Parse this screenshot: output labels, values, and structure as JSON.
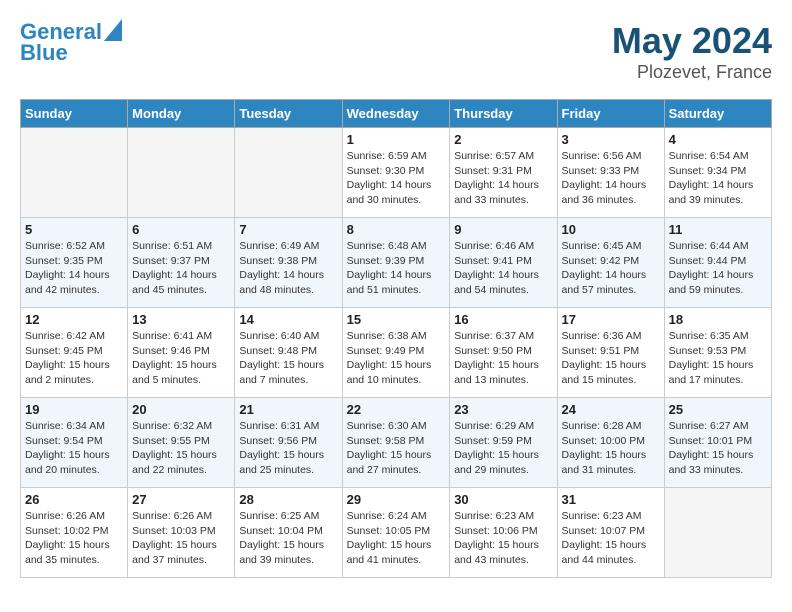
{
  "header": {
    "logo_line1": "General",
    "logo_line2": "Blue",
    "month": "May 2024",
    "location": "Plozevet, France"
  },
  "days_of_week": [
    "Sunday",
    "Monday",
    "Tuesday",
    "Wednesday",
    "Thursday",
    "Friday",
    "Saturday"
  ],
  "weeks": [
    [
      {
        "day": "",
        "info": ""
      },
      {
        "day": "",
        "info": ""
      },
      {
        "day": "",
        "info": ""
      },
      {
        "day": "1",
        "info": "Sunrise: 6:59 AM\nSunset: 9:30 PM\nDaylight: 14 hours\nand 30 minutes."
      },
      {
        "day": "2",
        "info": "Sunrise: 6:57 AM\nSunset: 9:31 PM\nDaylight: 14 hours\nand 33 minutes."
      },
      {
        "day": "3",
        "info": "Sunrise: 6:56 AM\nSunset: 9:33 PM\nDaylight: 14 hours\nand 36 minutes."
      },
      {
        "day": "4",
        "info": "Sunrise: 6:54 AM\nSunset: 9:34 PM\nDaylight: 14 hours\nand 39 minutes."
      }
    ],
    [
      {
        "day": "5",
        "info": "Sunrise: 6:52 AM\nSunset: 9:35 PM\nDaylight: 14 hours\nand 42 minutes."
      },
      {
        "day": "6",
        "info": "Sunrise: 6:51 AM\nSunset: 9:37 PM\nDaylight: 14 hours\nand 45 minutes."
      },
      {
        "day": "7",
        "info": "Sunrise: 6:49 AM\nSunset: 9:38 PM\nDaylight: 14 hours\nand 48 minutes."
      },
      {
        "day": "8",
        "info": "Sunrise: 6:48 AM\nSunset: 9:39 PM\nDaylight: 14 hours\nand 51 minutes."
      },
      {
        "day": "9",
        "info": "Sunrise: 6:46 AM\nSunset: 9:41 PM\nDaylight: 14 hours\nand 54 minutes."
      },
      {
        "day": "10",
        "info": "Sunrise: 6:45 AM\nSunset: 9:42 PM\nDaylight: 14 hours\nand 57 minutes."
      },
      {
        "day": "11",
        "info": "Sunrise: 6:44 AM\nSunset: 9:44 PM\nDaylight: 14 hours\nand 59 minutes."
      }
    ],
    [
      {
        "day": "12",
        "info": "Sunrise: 6:42 AM\nSunset: 9:45 PM\nDaylight: 15 hours\nand 2 minutes."
      },
      {
        "day": "13",
        "info": "Sunrise: 6:41 AM\nSunset: 9:46 PM\nDaylight: 15 hours\nand 5 minutes."
      },
      {
        "day": "14",
        "info": "Sunrise: 6:40 AM\nSunset: 9:48 PM\nDaylight: 15 hours\nand 7 minutes."
      },
      {
        "day": "15",
        "info": "Sunrise: 6:38 AM\nSunset: 9:49 PM\nDaylight: 15 hours\nand 10 minutes."
      },
      {
        "day": "16",
        "info": "Sunrise: 6:37 AM\nSunset: 9:50 PM\nDaylight: 15 hours\nand 13 minutes."
      },
      {
        "day": "17",
        "info": "Sunrise: 6:36 AM\nSunset: 9:51 PM\nDaylight: 15 hours\nand 15 minutes."
      },
      {
        "day": "18",
        "info": "Sunrise: 6:35 AM\nSunset: 9:53 PM\nDaylight: 15 hours\nand 17 minutes."
      }
    ],
    [
      {
        "day": "19",
        "info": "Sunrise: 6:34 AM\nSunset: 9:54 PM\nDaylight: 15 hours\nand 20 minutes."
      },
      {
        "day": "20",
        "info": "Sunrise: 6:32 AM\nSunset: 9:55 PM\nDaylight: 15 hours\nand 22 minutes."
      },
      {
        "day": "21",
        "info": "Sunrise: 6:31 AM\nSunset: 9:56 PM\nDaylight: 15 hours\nand 25 minutes."
      },
      {
        "day": "22",
        "info": "Sunrise: 6:30 AM\nSunset: 9:58 PM\nDaylight: 15 hours\nand 27 minutes."
      },
      {
        "day": "23",
        "info": "Sunrise: 6:29 AM\nSunset: 9:59 PM\nDaylight: 15 hours\nand 29 minutes."
      },
      {
        "day": "24",
        "info": "Sunrise: 6:28 AM\nSunset: 10:00 PM\nDaylight: 15 hours\nand 31 minutes."
      },
      {
        "day": "25",
        "info": "Sunrise: 6:27 AM\nSunset: 10:01 PM\nDaylight: 15 hours\nand 33 minutes."
      }
    ],
    [
      {
        "day": "26",
        "info": "Sunrise: 6:26 AM\nSunset: 10:02 PM\nDaylight: 15 hours\nand 35 minutes."
      },
      {
        "day": "27",
        "info": "Sunrise: 6:26 AM\nSunset: 10:03 PM\nDaylight: 15 hours\nand 37 minutes."
      },
      {
        "day": "28",
        "info": "Sunrise: 6:25 AM\nSunset: 10:04 PM\nDaylight: 15 hours\nand 39 minutes."
      },
      {
        "day": "29",
        "info": "Sunrise: 6:24 AM\nSunset: 10:05 PM\nDaylight: 15 hours\nand 41 minutes."
      },
      {
        "day": "30",
        "info": "Sunrise: 6:23 AM\nSunset: 10:06 PM\nDaylight: 15 hours\nand 43 minutes."
      },
      {
        "day": "31",
        "info": "Sunrise: 6:23 AM\nSunset: 10:07 PM\nDaylight: 15 hours\nand 44 minutes."
      },
      {
        "day": "",
        "info": ""
      }
    ]
  ]
}
